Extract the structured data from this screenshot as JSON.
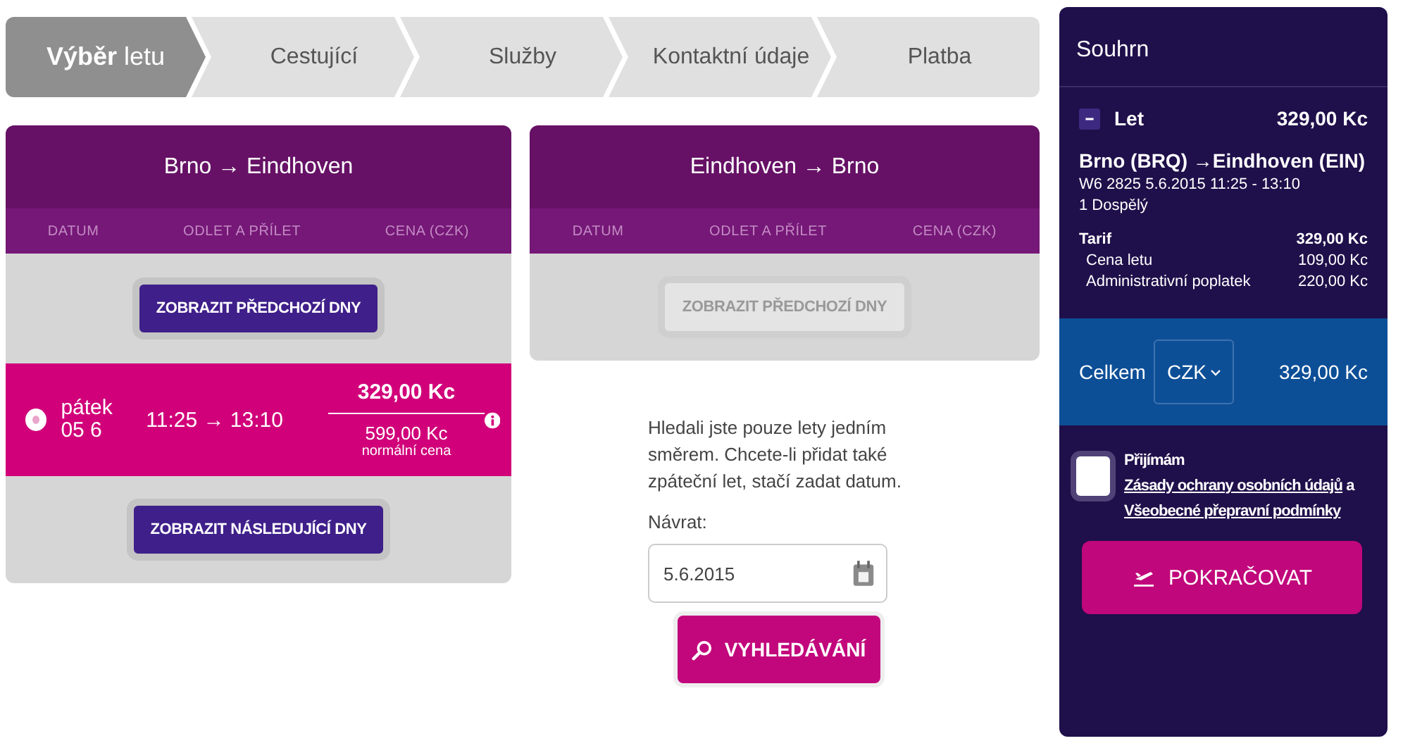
{
  "steps": [
    {
      "label": "**Výběr** letu",
      "selected": true
    },
    {
      "label": "Cestující",
      "selected": false
    },
    {
      "label": "Služby",
      "selected": false
    },
    {
      "label": "Kontaktní údaje",
      "selected": false
    },
    {
      "label": "Platba",
      "selected": false
    }
  ],
  "panels": [
    {
      "title": "Brno → Eindhoven",
      "columns": [
        "DATUM",
        "ODLET A PŘÍLET",
        "CENA (CZK)"
      ],
      "prev_button": {
        "label": "ZOBRAZIT PŘEDCHOZÍ DNY",
        "disabled": false
      },
      "flights": [
        {
          "day": "pátek",
          "date": "05 6",
          "time": "11:25 → 13:10",
          "price": "329,00 Kc",
          "normal_price": "599,00 Kc",
          "normal_label": "normální cena",
          "selected": true
        }
      ],
      "next_button": {
        "label": "ZOBRAZIT NÁSLEDUJÍCÍ DNY",
        "disabled": false
      }
    },
    {
      "title": "Eindhoven → Brno",
      "columns": [
        "DATUM",
        "ODLET A PŘÍLET",
        "CENA (CZK)"
      ],
      "prev_button": {
        "label": "ZOBRAZIT PŘEDCHOZÍ DNY",
        "disabled": true
      }
    }
  ],
  "return_search": {
    "note": "Hledali jste pouze lety jedním směrem. Chcete-li přidat také zpáteční let, stačí zadat datum.",
    "label": "Návrat:",
    "date": "5.6.2015",
    "button": "VYHLEDÁVÁNÍ"
  },
  "summary": {
    "title": "Souhrn",
    "section": {
      "label": "Let",
      "price": "329,00 Kc",
      "expanded": true
    },
    "route": "Brno (BRQ) →Eindhoven (EIN)",
    "details": "W6 2825  5.6.2015 11:25 - 13:10",
    "passengers": "1 Dospělý",
    "fares": [
      {
        "label": "Tarif",
        "value": "329,00 Kc",
        "kind": "total"
      },
      {
        "label": "Cena letu",
        "value": "109,00 Kc",
        "kind": "item"
      },
      {
        "label": "Administrativní poplatek",
        "value": "220,00 Kc",
        "kind": "item"
      }
    ],
    "total": {
      "label": "Celkem",
      "currency": "CZK",
      "amount": "329,00 Kc"
    },
    "agreement": {
      "checked": false,
      "parts": [
        {
          "kind": "text",
          "text": "Přijímám"
        },
        {
          "kind": "link",
          "text": "Zásady ochrany osobních údajů"
        },
        {
          "kind": "text",
          "text": "a"
        },
        {
          "kind": "link",
          "text": "Všeobecné přepravní podmínky"
        }
      ]
    },
    "continue_button": "POKRAČOVAT"
  }
}
